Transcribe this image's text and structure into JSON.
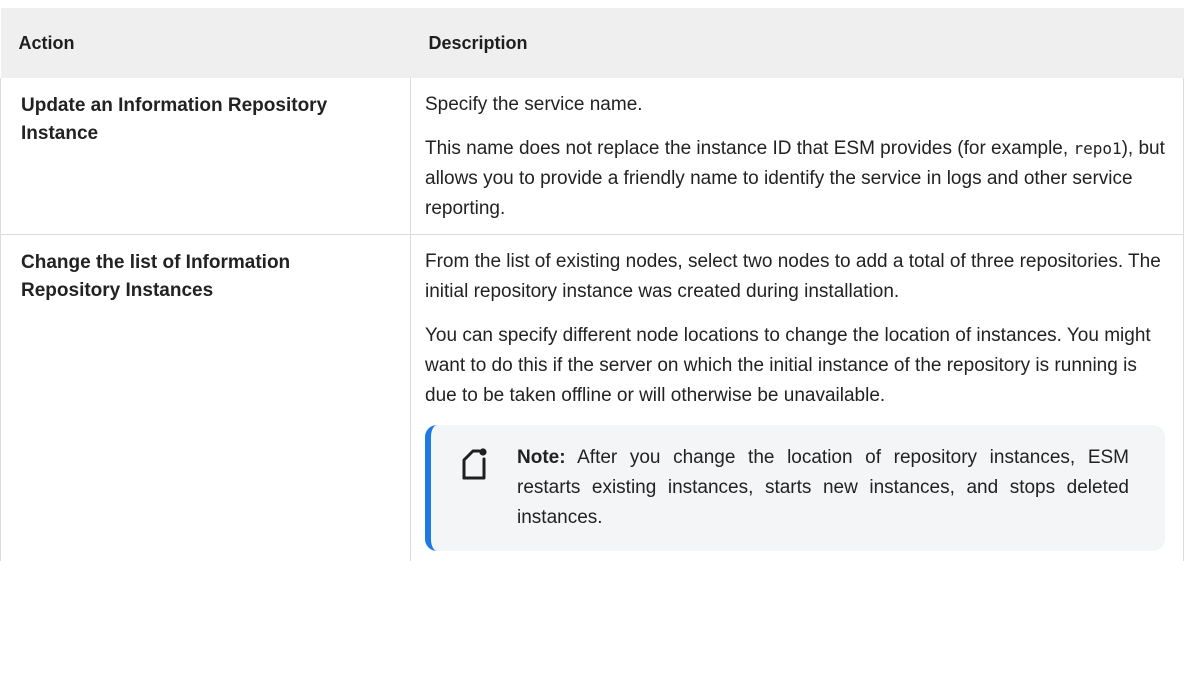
{
  "table": {
    "headers": {
      "action": "Action",
      "description": "Description"
    },
    "rows": [
      {
        "action": "Update an Information Repository Instance",
        "description": {
          "p1": "Specify the service name.",
          "p2_before": "This name does not replace the instance ID that ESM provides (for example, ",
          "p2_code": "repo1",
          "p2_after": "), but allows you to provide a friendly name to identify the service in logs and other service reporting."
        }
      },
      {
        "action": "Change the list of Information Repository Instances",
        "description": {
          "p1": "From the list of existing nodes, select two nodes to add a total of three repositories. The initial repository instance was created during installation.",
          "p2": "You can specify different node locations to change the location of instances. You might want to do this if the server on which the initial instance of the repository is running is due to be taken offline or will otherwise be unavailable."
        },
        "note": {
          "icon": "note-icon",
          "label": "Note:",
          "text": "After you change the location of repository instances, ESM restarts existing instances, starts new instances, and stops deleted instances."
        }
      }
    ]
  },
  "colors": {
    "header_bg": "#efefef",
    "note_bg": "#f4f5f7",
    "note_accent": "#1e7ae0"
  }
}
